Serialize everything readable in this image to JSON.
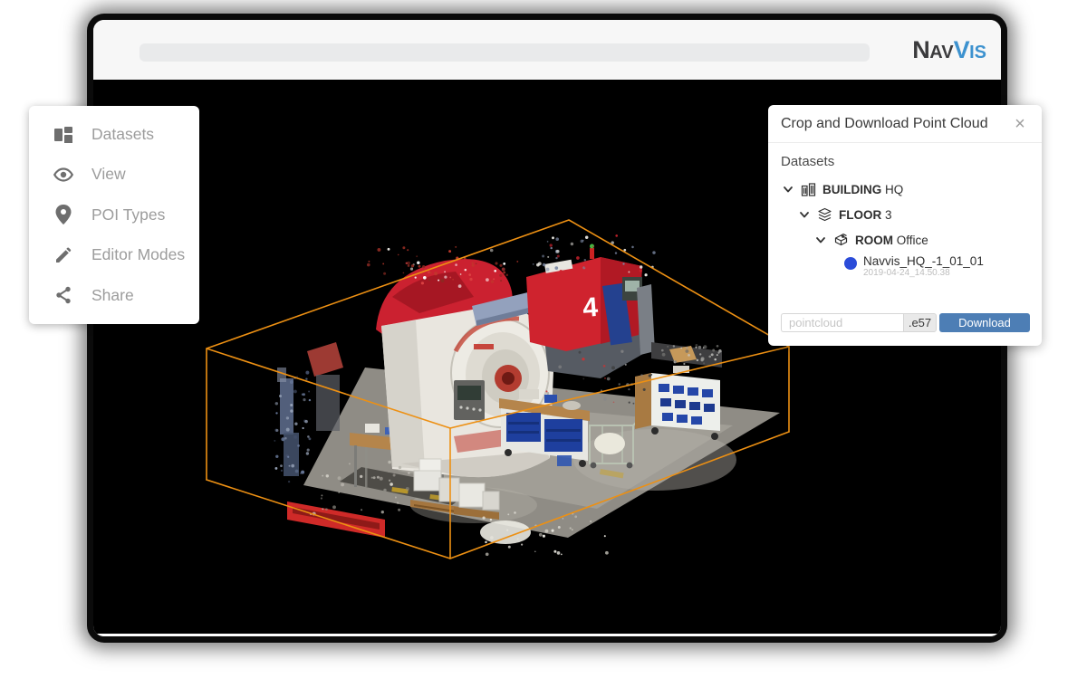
{
  "window": {
    "logo": {
      "n_big": "N",
      "n_small": "AV",
      "v_big": "V",
      "v_small": "IS"
    }
  },
  "sidebar": {
    "items": [
      {
        "label": "Datasets",
        "icon": "dashboard-icon"
      },
      {
        "label": "View",
        "icon": "eye-icon"
      },
      {
        "label": "POI Types",
        "icon": "map-pin-icon"
      },
      {
        "label": "Editor Modes",
        "icon": "pencil-icon"
      },
      {
        "label": "Share",
        "icon": "share-icon"
      }
    ]
  },
  "crop_panel": {
    "title": "Crop and Download Point Cloud",
    "close_label": "×",
    "section_label": "Datasets",
    "tree": [
      {
        "level": 0,
        "icon": "building-icon",
        "bold": "BUILDING",
        "regular": "HQ"
      },
      {
        "level": 1,
        "icon": "floor-icon",
        "bold": "FLOOR",
        "regular": "3"
      },
      {
        "level": 2,
        "icon": "room-icon",
        "bold": "ROOM",
        "regular": "Office"
      }
    ],
    "dataset": {
      "name": "Navvis_HQ_-1_01_01",
      "timestamp": "2019-04-24_14.50.38"
    },
    "download": {
      "filename_placeholder": "pointcloud",
      "extension": ".e57",
      "button_label": "Download"
    }
  },
  "scene": {
    "machine_label": "4"
  },
  "colors": {
    "crop_box_orange": "#ED9013",
    "download_blue": "#4d7eb5",
    "dataset_dot_blue": "#2b4cd9",
    "logo_blue": "#3d92cf",
    "logo_dark": "#3b3b3d",
    "chrome_bg": "#f7f7f7",
    "canvas_bg": "#000000"
  }
}
